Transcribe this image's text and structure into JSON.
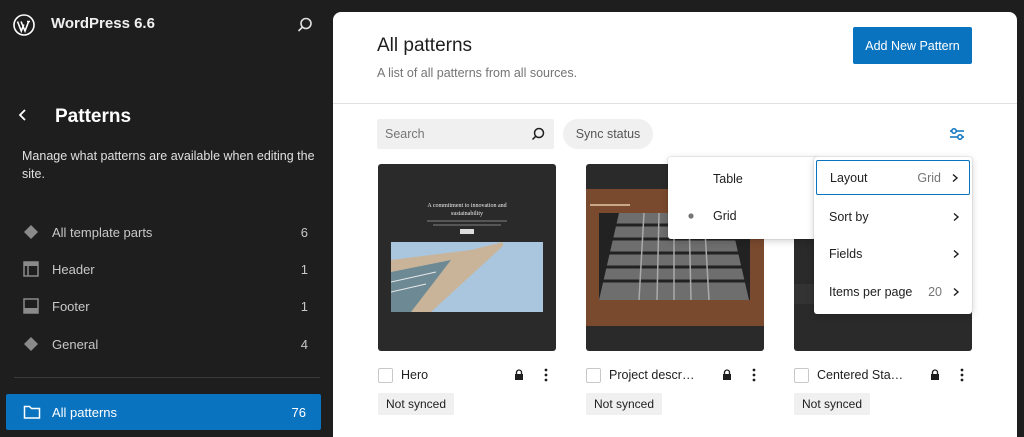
{
  "sidebar": {
    "site_title": "WordPress 6.6",
    "title": "Patterns",
    "description": "Manage what patterns are available when editing the site.",
    "items": [
      {
        "label": "All template parts",
        "count": "6",
        "icon": "template-parts-icon"
      },
      {
        "label": "Header",
        "count": "1",
        "icon": "header-icon"
      },
      {
        "label": "Footer",
        "count": "1",
        "icon": "footer-icon"
      },
      {
        "label": "General",
        "count": "4",
        "icon": "general-icon"
      }
    ],
    "active": {
      "label": "All patterns",
      "count": "76",
      "icon": "folder-icon"
    }
  },
  "main": {
    "title": "All patterns",
    "description": "A list of all patterns from all sources.",
    "add_button": "Add New Pattern",
    "search_placeholder": "Search",
    "sync_filter": "Sync status"
  },
  "cards": [
    {
      "title": "Hero",
      "badge": "Not synced",
      "thumb_heading": "A commitment to innovation and sustainability"
    },
    {
      "title": "Project descr…",
      "badge": "Not synced"
    },
    {
      "title": "Centered Sta…",
      "badge": "Not synced"
    }
  ],
  "layout_menu": {
    "options": [
      "Table",
      "Grid"
    ],
    "selected": "Grid"
  },
  "view_menu": {
    "items": [
      {
        "label": "Layout",
        "value": "Grid"
      },
      {
        "label": "Sort by",
        "value": ""
      },
      {
        "label": "Fields",
        "value": ""
      },
      {
        "label": "Items per page",
        "value": "20"
      }
    ]
  },
  "colors": {
    "accent": "#0a73c0",
    "sidebar_bg": "#1e1e1e",
    "card_dark": "#2a2a2a",
    "card_brown": "#7a4a2e"
  }
}
